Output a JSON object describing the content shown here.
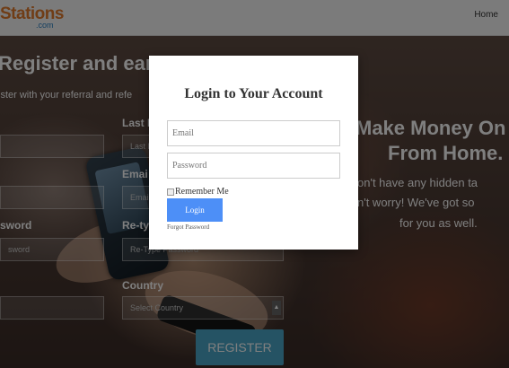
{
  "header": {
    "logo_text": "Stations",
    "logo_sub": ".com",
    "nav_home": "Home"
  },
  "register": {
    "title": "Register and ear",
    "subtitle": "ister with your referral and refe",
    "last_name_label": "Last N",
    "last_name_placeholder": "Last N",
    "email_label": "Emai",
    "email_placeholder": "Emai",
    "password_label": "sword",
    "password_placeholder": "sword",
    "retype_label": "Re-ty",
    "retype_placeholder": "Re-Type Password",
    "country_label": "Country",
    "country_value": "Select Country",
    "register_button": "REGISTER"
  },
  "hero": {
    "line1": "Make Money On",
    "line2": "From Home.",
    "para1": "on't have any hidden ta",
    "para2": "n't worry! We've got so",
    "para3": "for you as well."
  },
  "login_modal": {
    "title": "Login to Your Account",
    "email_placeholder": "Email",
    "password_placeholder": "Password",
    "remember_label": "Remember Me",
    "login_button": "Login",
    "forgot_link": "Forgot Password"
  },
  "colors": {
    "logo_orange": "#e07a2c",
    "login_button_blue": "#4d8ff7",
    "register_button_teal": "#4aa7c8"
  }
}
